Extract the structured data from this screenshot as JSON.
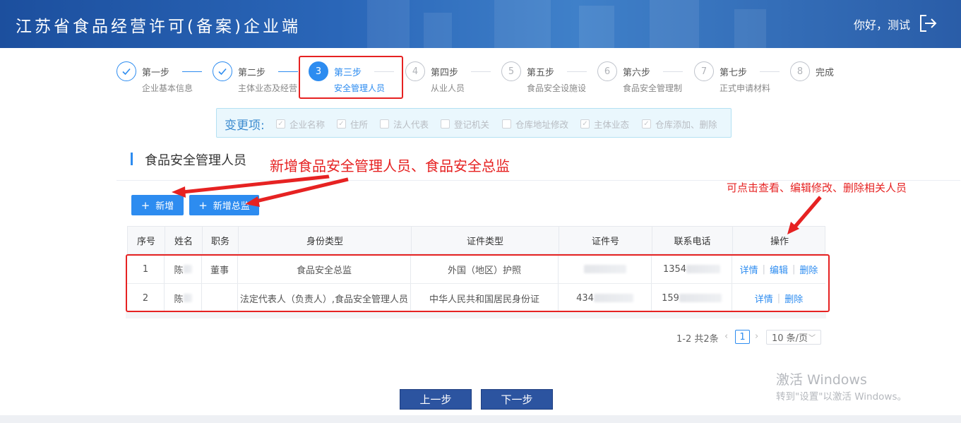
{
  "header": {
    "title": "江苏省食品经营许可(备案)企业端",
    "greeting": "你好，测试",
    "logout_icon": "logout-icon"
  },
  "steps": [
    {
      "num": "1",
      "title": "第一步",
      "desc": "企业基本信息",
      "state": "done"
    },
    {
      "num": "2",
      "title": "第二步",
      "desc": "主体业态及经营",
      "state": "done"
    },
    {
      "num": "3",
      "title": "第三步",
      "desc": "安全管理人员",
      "state": "active"
    },
    {
      "num": "4",
      "title": "第四步",
      "desc": "从业人员",
      "state": "todo"
    },
    {
      "num": "5",
      "title": "第五步",
      "desc": "食品安全设施设",
      "state": "todo"
    },
    {
      "num": "6",
      "title": "第六步",
      "desc": "食品安全管理制",
      "state": "todo"
    },
    {
      "num": "7",
      "title": "第七步",
      "desc": "正式申请材料",
      "state": "todo"
    },
    {
      "num": "8",
      "title": "完成",
      "desc": "",
      "state": "todo"
    }
  ],
  "changes": {
    "label": "变更项:",
    "items": [
      {
        "label": "企业名称",
        "checked": true
      },
      {
        "label": "住所",
        "checked": true
      },
      {
        "label": "法人代表",
        "checked": false
      },
      {
        "label": "登记机关",
        "checked": false
      },
      {
        "label": "仓库地址修改",
        "checked": false
      },
      {
        "label": "主体业态",
        "checked": true
      },
      {
        "label": "仓库添加、删除",
        "checked": true
      }
    ]
  },
  "section": {
    "title": "食品安全管理人员"
  },
  "annotations": {
    "add": "新增食品安全管理人员、食品安全总监",
    "ops": "可点击查看、编辑修改、删除相关人员"
  },
  "buttons": {
    "add": "新增",
    "add_director": "新增总监",
    "prev": "上一步",
    "next": "下一步"
  },
  "table": {
    "columns": [
      "序号",
      "姓名",
      "职务",
      "身份类型",
      "证件类型",
      "证件号",
      "联系电话",
      "操作"
    ],
    "rows": [
      {
        "no": "1",
        "name": "陈",
        "position": "董事",
        "identity": "食品安全总监",
        "cert_type": "外国（地区）护照",
        "cert_no": "",
        "phone": "1354",
        "actions": [
          "详情",
          "编辑",
          "删除"
        ]
      },
      {
        "no": "2",
        "name": "陈",
        "position": "",
        "identity": "法定代表人（负责人）,食品安全管理人员",
        "cert_type": "中华人民共和国居民身份证",
        "cert_no": "434",
        "phone": "159",
        "actions": [
          "详情",
          "删除"
        ]
      }
    ]
  },
  "pagination": {
    "summary": "1-2 共2条",
    "current": "1",
    "page_size": "10 条/页"
  },
  "watermark": {
    "line1": "激活 Windows",
    "line2": "转到\"设置\"以激活 Windows。"
  },
  "colors": {
    "primary": "#2d8cf0",
    "header": "#2a66b8",
    "annotation": "#e62222",
    "nav_button": "#2c54a0"
  }
}
